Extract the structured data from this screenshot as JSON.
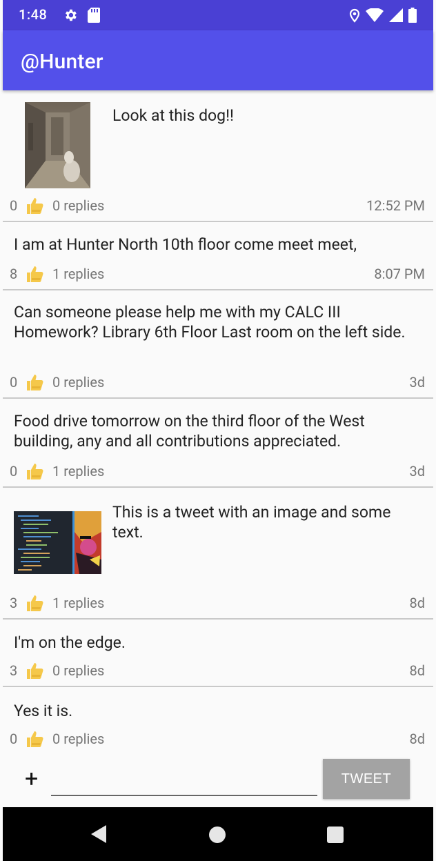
{
  "status_bar": {
    "time": "1:48",
    "icons": [
      "gear-icon",
      "sd-card-icon",
      "location-icon",
      "wifi-icon",
      "signal-icon",
      "battery-icon"
    ]
  },
  "app_bar": {
    "title": "@Hunter"
  },
  "tweets": [
    {
      "text": "Look at this dog!!",
      "likes": "0",
      "replies": "0 replies",
      "time": "12:52 PM",
      "image": "dog-photo"
    },
    {
      "text": "I am at Hunter North 10th floor come meet meet,",
      "likes": "8",
      "replies": "1 replies",
      "time": "8:07 PM"
    },
    {
      "text": "Can someone please help me with my CALC III Homework? Library 6th Floor Last room on the left side.",
      "likes": "0",
      "replies": "0 replies",
      "time": "3d"
    },
    {
      "text": "Food drive tomorrow on the third floor of the West building, any and all contributions appreciated.",
      "likes": "0",
      "replies": "1 replies",
      "time": "3d"
    },
    {
      "text": "This is a tweet with an image and some text.",
      "likes": "3",
      "replies": "1 replies",
      "time": "8d",
      "image": "code-screenshot"
    },
    {
      "text": "I'm on the edge.",
      "likes": "3",
      "replies": "0 replies",
      "time": "8d"
    },
    {
      "text": "Yes it is.",
      "likes": "0",
      "replies": "0 replies",
      "time": "8d"
    }
  ],
  "composer": {
    "plus_label": "+",
    "input_value": "",
    "tweet_button_label": "TWEET"
  },
  "colors": {
    "status_bar": "#4a40d4",
    "app_bar": "#5350ea",
    "tweet_button": "#a3a3a3",
    "thumb": "#f5c84a"
  }
}
